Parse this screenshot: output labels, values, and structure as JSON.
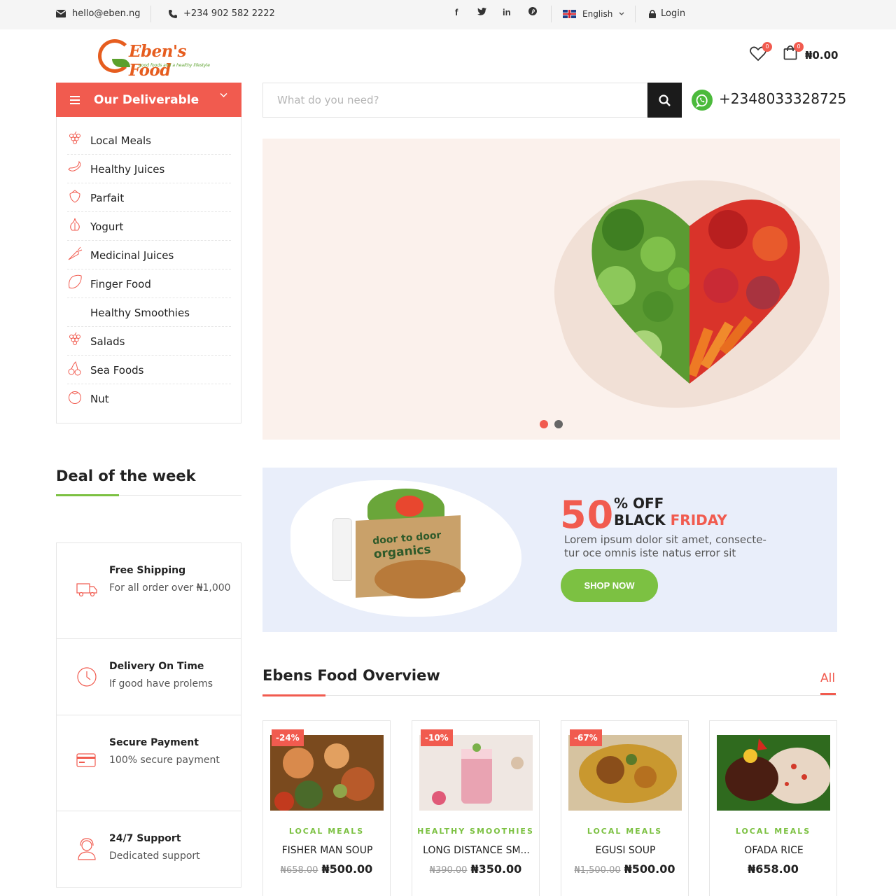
{
  "topbar": {
    "email": "hello@eben.ng",
    "phone": "+234 902 582 2222",
    "language": "English",
    "login": "Login"
  },
  "header": {
    "logo_text": "Eben's Food",
    "logo_tagline": "good foods and a healthy lifestyle",
    "wishlist_count": "0",
    "cart_count": "0",
    "cart_total": "₦0.00"
  },
  "categories": {
    "title": "Our Deliverable",
    "items": [
      {
        "label": "Local Meals",
        "icon": "grapes-icon"
      },
      {
        "label": "Healthy Juices",
        "icon": "banana-icon"
      },
      {
        "label": "Parfait",
        "icon": "strawberry-icon"
      },
      {
        "label": "Yogurt",
        "icon": "garlic-icon"
      },
      {
        "label": "Medicinal Juices",
        "icon": "carrot-icon"
      },
      {
        "label": "Finger Food",
        "icon": "lemon-icon"
      },
      {
        "label": "Healthy Smoothies",
        "icon": ""
      },
      {
        "label": "Salads",
        "icon": "grapes-icon"
      },
      {
        "label": "Sea Foods",
        "icon": "cherry-icon"
      },
      {
        "label": "Nut",
        "icon": "tomato-icon"
      }
    ]
  },
  "search": {
    "placeholder": "What do you need?",
    "whatsapp": "+2348033328725"
  },
  "hero": {
    "slides": 2,
    "active_slide": 1
  },
  "deal": {
    "title": "Deal of the week"
  },
  "features": [
    {
      "title": "Free Shipping",
      "desc": "For all order over ₦1,000",
      "icon": "truck-icon"
    },
    {
      "title": "Delivery On Time",
      "desc": "If good have prolems",
      "icon": "clock-icon"
    },
    {
      "title": "Secure Payment",
      "desc": "100% secure payment",
      "icon": "credit-card-icon"
    },
    {
      "title": "24/7 Support",
      "desc": "Dedicated support",
      "icon": "support-agent-icon"
    }
  ],
  "promo": {
    "percent": "50",
    "off": "% OFF",
    "black": "BLACK",
    "friday": "FRIDAY",
    "desc": "Lorem ipsum dolor sit amet, consecte-tur oce omnis iste natus error sit",
    "box_text_1": "door to door",
    "box_text_2": "organics",
    "button": "SHOP NOW"
  },
  "overview": {
    "title": "Ebens Food Overview",
    "filter_all": "All",
    "products": [
      {
        "discount": "-24%",
        "category": "LOCAL MEALS",
        "name": "FISHER MAN SOUP",
        "old_price": "₦658.00",
        "price": "₦500.00"
      },
      {
        "discount": "-10%",
        "category": "HEALTHY SMOOTHIES",
        "name": "LONG DISTANCE SM...",
        "old_price": "₦390.00",
        "price": "₦350.00"
      },
      {
        "discount": "-67%",
        "category": "LOCAL MEALS",
        "name": "EGUSI SOUP",
        "old_price": "₦1,500.00",
        "price": "₦500.00"
      },
      {
        "discount": "",
        "category": "LOCAL MEALS",
        "name": "OFADA RICE",
        "old_price": "",
        "price": "₦658.00"
      }
    ]
  },
  "colors": {
    "accent_red": "#f15b4f",
    "accent_green": "#7cc142",
    "dark": "#1b1b1b"
  }
}
